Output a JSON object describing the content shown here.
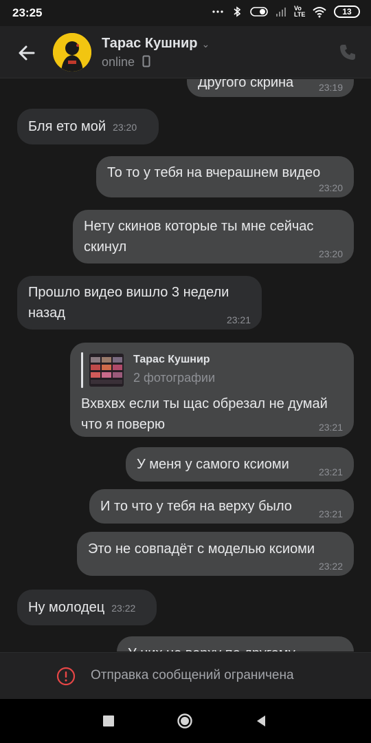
{
  "status_bar": {
    "time": "23:25",
    "network": "Vo LTE",
    "battery": "13"
  },
  "header": {
    "name": "Тарас Кушнир",
    "status": "online"
  },
  "messages": [
    {
      "text": "Другого скрина",
      "time": "23:19"
    },
    {
      "text": "Бля ето мой",
      "time": "23:20"
    },
    {
      "text": "То то у тебя на вчерашнем видео",
      "time": "23:20"
    },
    {
      "text": "Нету скинов которые ты мне сейчас скинул",
      "time": "23:20"
    },
    {
      "text": "Прошло видео вишло 3 недели назад",
      "time": "23:21"
    },
    {
      "reply_name": "Тарас Кушнир",
      "reply_sub": "2 фотографии",
      "text": "Вхвхвх если ты щас обрезал не думай что я поверю",
      "time": "23:21"
    },
    {
      "text": "У меня у самого ксиоми",
      "time": "23:21"
    },
    {
      "text": "И то что у тебя на верху было",
      "time": "23:21"
    },
    {
      "text": "Это не совпадёт с моделью ксиоми",
      "time": "23:22"
    },
    {
      "text": "Ну молодец",
      "time": "23:22"
    },
    {
      "text": "У них не верху по другому"
    }
  ],
  "footer": {
    "text": "Отправка сообщений ограничена"
  },
  "colors": {
    "bubble_out": "#454647",
    "bubble_in": "#2d2e30",
    "background": "#191919",
    "warning": "#e64646"
  },
  "icons": [
    "back-arrow-icon",
    "phone-icon",
    "warning-icon",
    "recent-apps-icon",
    "home-icon",
    "back-nav-icon"
  ]
}
